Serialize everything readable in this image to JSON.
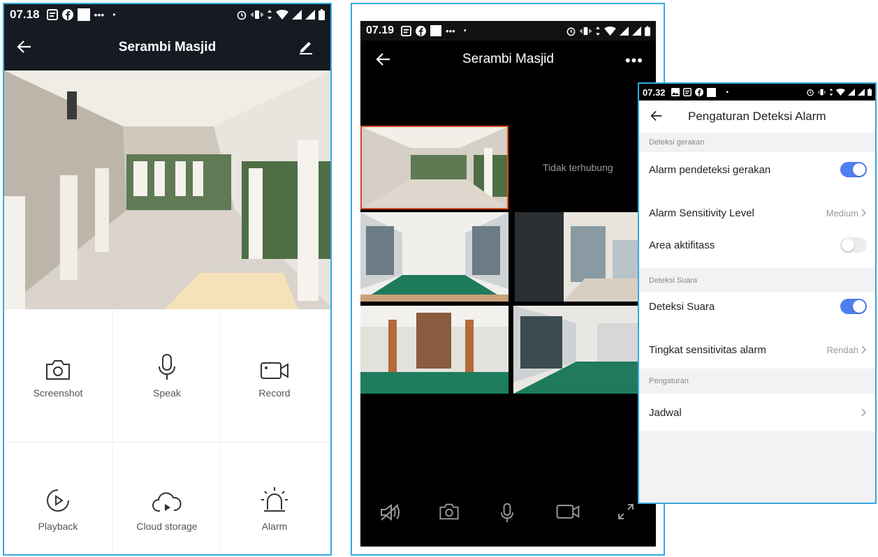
{
  "panel1": {
    "status": {
      "time": "07.18"
    },
    "title": "Serambi Masjid",
    "actions": [
      {
        "label": "Screenshot",
        "icon": "camera-icon"
      },
      {
        "label": "Speak",
        "icon": "microphone-icon"
      },
      {
        "label": "Record",
        "icon": "video-camera-icon"
      },
      {
        "label": "Playback",
        "icon": "playback-icon"
      },
      {
        "label": "Cloud storage",
        "icon": "cloud-storage-icon"
      },
      {
        "label": "Alarm",
        "icon": "alarm-siren-icon"
      }
    ]
  },
  "panel2": {
    "status": {
      "time": "07.19"
    },
    "title": "Serambi Masjid",
    "more": "•••",
    "disconnected": "Tidak terhubung"
  },
  "panel3": {
    "status": {
      "time": "07.32"
    },
    "title": "Pengaturan Deteksi Alarm",
    "sections": {
      "motion": "Deteksi gerakan",
      "sound": "Deteksi Suara",
      "settings": "Pengaturan"
    },
    "rows": {
      "motion_alarm": {
        "label": "Alarm pendeteksi gerakan",
        "on": true
      },
      "sensitivity": {
        "label": "Alarm Sensitivity Level",
        "value": "Medium"
      },
      "area": {
        "label": "Area aktifitass",
        "on": false
      },
      "sound_detect": {
        "label": "Deteksi Suara",
        "on": true
      },
      "sound_sensitivity": {
        "label": "Tingkat sensitivitas alarm",
        "value": "Rendah"
      },
      "schedule": {
        "label": "Jadwal"
      }
    }
  },
  "colors": {
    "accent_border": "#35a9e0",
    "toggle_on": "#4f7ef0",
    "dark_bar": "#161a22",
    "selected_frame": "#d04a1e"
  }
}
